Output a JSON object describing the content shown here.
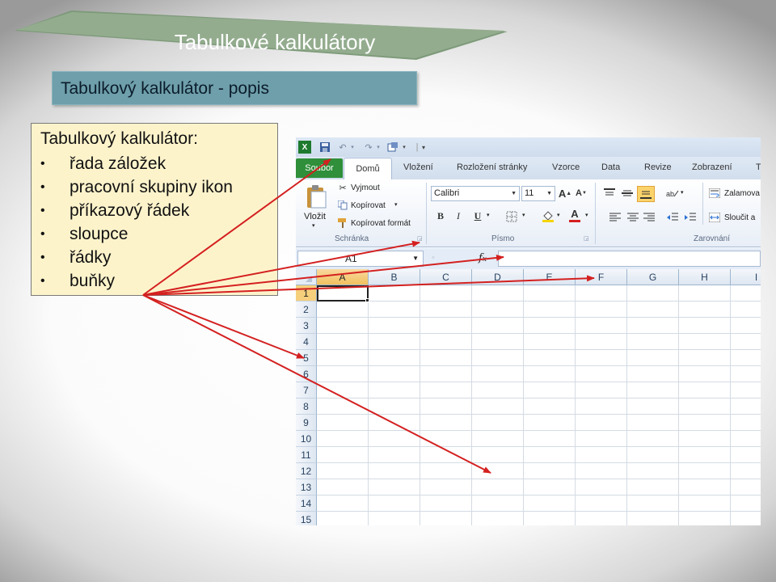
{
  "slide": {
    "title": "Tabulkové kalkulátory",
    "subtitle": "Tabulkový kalkulátor - popis",
    "description": {
      "heading": "Tabulkový kalkulátor:",
      "items": [
        "řada záložek",
        "pracovní skupiny ikon",
        "příkazový řádek",
        "sloupce",
        "řádky",
        "buňky"
      ]
    }
  },
  "excel": {
    "tabs": [
      "Soubor",
      "Domů",
      "Vložení",
      "Rozložení stránky",
      "Vzorce",
      "Data",
      "Revize",
      "Zobrazení",
      "T"
    ],
    "clipboard": {
      "paste_label": "Vložit",
      "cut_label": "Vyjmout",
      "copy_label": "Kopírovat",
      "format_painter_label": "Kopírovat formát",
      "group_label": "Schránka"
    },
    "font": {
      "name": "Calibri",
      "size": "11",
      "bold": "B",
      "italic": "I",
      "underline": "U",
      "group_label": "Písmo"
    },
    "alignment": {
      "wrap_label": "Zalamova",
      "merge_label": "Sloučit a",
      "group_label": "Zarovnání"
    },
    "formula_bar": {
      "name_box": "A1",
      "fx": "fx",
      "value": ""
    },
    "columns": [
      "A",
      "B",
      "C",
      "D",
      "E",
      "F",
      "G",
      "H",
      "I"
    ],
    "rows": [
      "1",
      "2",
      "3",
      "4",
      "5",
      "6",
      "7",
      "8",
      "9",
      "10",
      "11",
      "12",
      "13",
      "14",
      "15"
    ],
    "active_cell": "A1"
  },
  "colors": {
    "banner": "#90aa8c",
    "subtitle_box": "#6e9faa",
    "description_box": "#fdf3cb",
    "arrow": "#d42020",
    "file_tab": "#2f8f3a"
  }
}
